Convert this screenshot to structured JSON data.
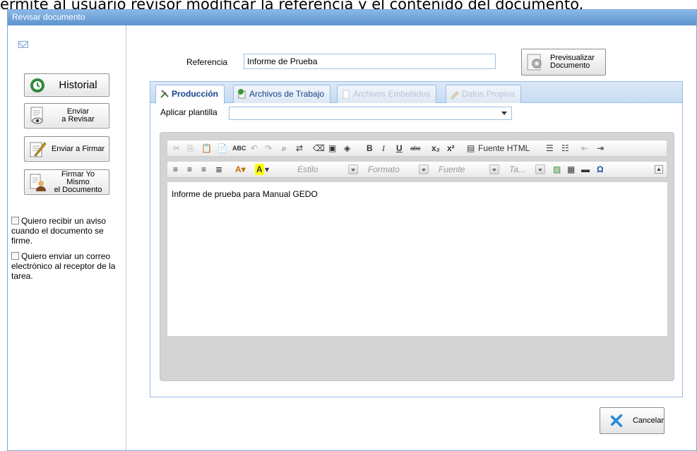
{
  "caption": "ermite al usuario revisor modificar la referencia y el contenido del documento.",
  "window": {
    "title": "Revisar documento"
  },
  "left": {
    "historial": "Historial",
    "enviar_revisar_1": "Enviar",
    "enviar_revisar_2": "a Revisar",
    "enviar_firmar": "Enviar a Firmar",
    "firmar_yo_1": "Firmar Yo Mismo",
    "firmar_yo_2": "el Documento",
    "aviso": "Quiero recibir un aviso cuando el documento se firme.",
    "correo": "Quiero enviar un correo electrónico al receptor de la tarea."
  },
  "main": {
    "referencia_label": "Referencia",
    "referencia_value": "Informe de Prueba",
    "preview_1": "Previsualizar",
    "preview_2": "Documento",
    "tabs": [
      {
        "label": "Producción"
      },
      {
        "label": "Archivos de Trabajo"
      },
      {
        "label": "Archivos Embebidos"
      },
      {
        "label": "Datos Propios"
      }
    ],
    "plantilla_label": "Aplicar plantilla",
    "toolbar": {
      "fuente_html": "Fuente HTML",
      "estilo": "Estilo",
      "formato": "Formato",
      "fuente": "Fuente",
      "tamano": "Ta..."
    },
    "content": "Informe de prueba para Manual GEDO",
    "cancelar": "Cancelar"
  },
  "colors": {
    "accent": "#15428b",
    "border": "#99bbe8",
    "titlebar": "#6a9fd6"
  }
}
